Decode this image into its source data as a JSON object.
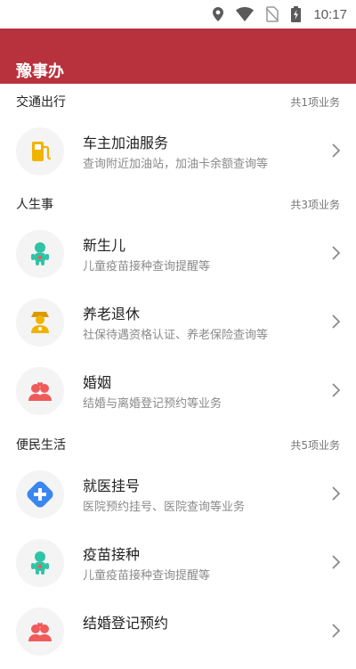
{
  "status_bar": {
    "time": "10:17",
    "icons": [
      "location-icon",
      "wifi-icon",
      "no-sim-icon",
      "battery-charging-icon"
    ]
  },
  "app": {
    "title": "豫事办"
  },
  "colors": {
    "header": "#b8323e",
    "accent_teal": "#2ec4a6",
    "accent_orange": "#f0b400",
    "accent_red": "#f05a5a",
    "accent_blue": "#3a86ef"
  },
  "sections": [
    {
      "title": "交通出行",
      "count": "共1项业务",
      "items": [
        {
          "title": "车主加油服务",
          "subtitle": "查询附近加油站，加油卡余额查询等",
          "icon": "fuel-pump-icon"
        }
      ]
    },
    {
      "title": "人生事",
      "count": "共3项业务",
      "items": [
        {
          "title": "新生儿",
          "subtitle": "儿童疫苗接种查询提醒等",
          "icon": "baby-icon"
        },
        {
          "title": "养老退休",
          "subtitle": "社保待遇资格认证、养老保险查询等",
          "icon": "elderly-icon"
        },
        {
          "title": "婚姻",
          "subtitle": "结婚与离婚登记预约等业务",
          "icon": "couple-icon"
        }
      ]
    },
    {
      "title": "便民生活",
      "count": "共5项业务",
      "items": [
        {
          "title": "就医挂号",
          "subtitle": "医院预约挂号、医院查询等业务",
          "icon": "medical-cross-icon"
        },
        {
          "title": "疫苗接种",
          "subtitle": "儿童疫苗接种查询提醒等",
          "icon": "baby-icon"
        },
        {
          "title": "结婚登记预约",
          "subtitle": "",
          "icon": "couple-icon"
        }
      ]
    }
  ]
}
